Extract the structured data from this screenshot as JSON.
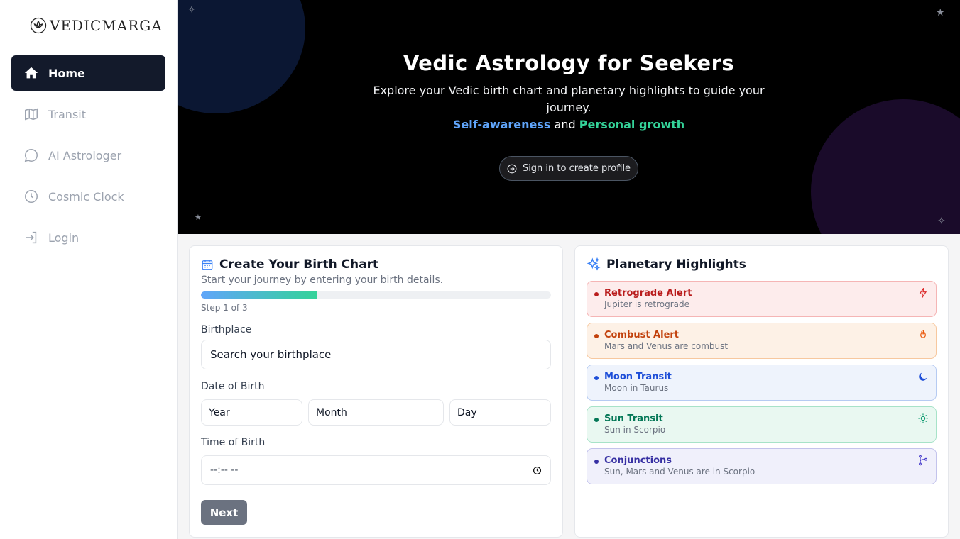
{
  "app": {
    "name": "VEDICMARGA"
  },
  "sidebar": {
    "items": [
      {
        "label": "Home",
        "icon": "home-icon",
        "active": true
      },
      {
        "label": "Transit",
        "icon": "map-icon"
      },
      {
        "label": "AI Astrologer",
        "icon": "chat-icon"
      },
      {
        "label": "Cosmic Clock",
        "icon": "clock-icon"
      },
      {
        "label": "Login",
        "icon": "login-icon"
      }
    ]
  },
  "hero": {
    "title": "Vedic Astrology for Seekers",
    "subtitle": "Explore your Vedic birth chart and planetary highlights to guide your journey.",
    "tag_a": "Self-awareness",
    "tag_and": "and",
    "tag_b": "Personal growth",
    "signin_label": "Sign in to create profile"
  },
  "birth_chart": {
    "title": "Create Your Birth Chart",
    "description": "Start your journey by entering your birth details.",
    "progress": 0.333,
    "step_label": "Step 1 of 3",
    "birthplace_label": "Birthplace",
    "birthplace_placeholder": "Search your birthplace",
    "dob_label": "Date of Birth",
    "year_placeholder": "Year",
    "month_placeholder": "Month",
    "day_placeholder": "Day",
    "tob_label": "Time of Birth",
    "time_placeholder": "--:-- --",
    "next_label": "Next"
  },
  "highlights": {
    "title": "Planetary Highlights",
    "items": [
      {
        "title": "Retrograde Alert",
        "subtitle": "Jupiter is retrograde",
        "color": "#b91c1c",
        "bg": "#fdecec",
        "border": "#f5b5b5",
        "icon": "lightning-icon"
      },
      {
        "title": "Combust Alert",
        "subtitle": "Mars and Venus are combust",
        "color": "#c2410c",
        "bg": "#fdf1e6",
        "border": "#f7c89f",
        "icon": "flame-icon"
      },
      {
        "title": "Moon Transit",
        "subtitle": "Moon in Taurus",
        "color": "#1d4ed8",
        "bg": "#eef3fc",
        "border": "#b6cbf2",
        "icon": "moon-icon"
      },
      {
        "title": "Sun Transit",
        "subtitle": "Sun in Scorpio",
        "color": "#047857",
        "bg": "#e9f8f1",
        "border": "#a7e3c8",
        "icon": "sun-icon"
      },
      {
        "title": "Conjunctions",
        "subtitle": "Sun, Mars and Venus are in Scorpio",
        "color": "#3730a3",
        "bg": "#f0f0fb",
        "border": "#c3c3ec",
        "icon": "branch-icon"
      }
    ]
  }
}
